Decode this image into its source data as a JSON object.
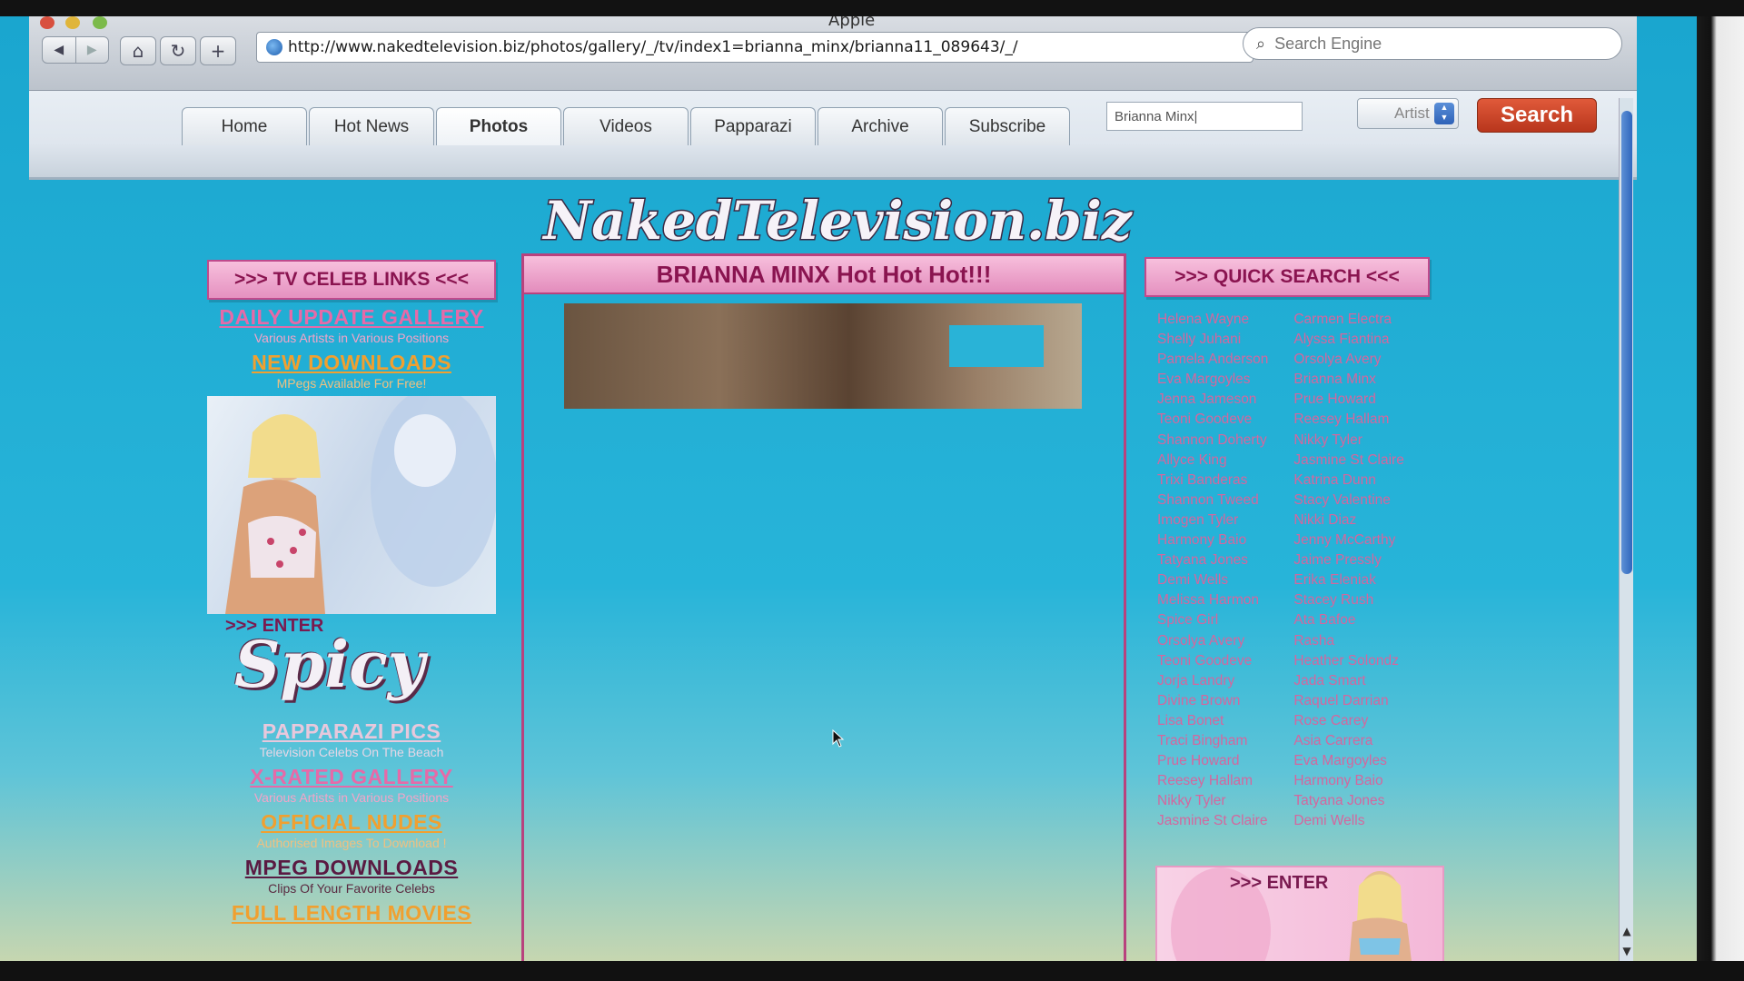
{
  "browser": {
    "title": "Apple",
    "url": "http://www.nakedtelevision.biz/photos/gallery/_/tv/index1=brianna_minx/brianna11_089643/_/",
    "search_placeholder": "Search Engine"
  },
  "site": {
    "logo_text": "NakedTelevision.biz",
    "nav_tabs": [
      {
        "label": "Home"
      },
      {
        "label": "Hot News"
      },
      {
        "label": "Photos"
      },
      {
        "label": "Videos"
      },
      {
        "label": "Papparazi"
      },
      {
        "label": "Archive"
      },
      {
        "label": "Subscribe"
      }
    ],
    "search": {
      "value": "Brianna Minx|",
      "filter": "Artist",
      "button": "Search"
    },
    "left": {
      "header": ">>> TV CELEB LINKS <<<",
      "links": [
        {
          "title": "DAILY UPDATE GALLERY",
          "sub": "Various Artists in Various Positions"
        },
        {
          "title": "NEW DOWNLOADS",
          "sub": "MPegs Available For Free!"
        }
      ],
      "enter_label": ">>> ENTER",
      "spicy": "Spicy",
      "links2": [
        {
          "title": "PAPPARAZI PICS",
          "sub": "Television Celebs On The Beach"
        },
        {
          "title": "X-RATED GALLERY",
          "sub": "Various Artists in Various Positions"
        },
        {
          "title": "OFFICIAL NUDES",
          "sub": "Authorised Images To Download !"
        },
        {
          "title": "MPEG DOWNLOADS",
          "sub": "Clips Of Your Favorite Celebs"
        },
        {
          "title": "FULL LENGTH MOVIES",
          "sub": ""
        }
      ]
    },
    "center": {
      "header": "BRIANNA MINX  Hot Hot Hot!!!"
    },
    "quick_search": {
      "header": ">>> QUICK SEARCH <<<",
      "col1": [
        "Helena Wayne",
        "Shelly Juhani",
        "Pamela Anderson",
        "Eva Margoyles",
        "Jenna Jameson",
        "Teoni Goodeve",
        "Shannon Doherty",
        "Allyce King",
        "Trixi Banderas",
        "Shannon Tweed",
        "Imogen Tyler",
        "Harmony Baio",
        "Tatyana Jones",
        "Demi Wells",
        "Melissa Harmon",
        "Spice Girl",
        "Orsolya Avery",
        "Teoni Goodeve",
        "Jorja Landry",
        "Divine Brown",
        "Lisa Bonet",
        "Traci Bingham",
        "Prue Howard",
        "Reesey Hallam",
        "Nikky Tyler",
        "Jasmine St Claire"
      ],
      "col2": [
        "Carmen Electra",
        "Alyssa Fiantina",
        "Orsolya Avery",
        "Brianna Minx",
        "Prue Howard",
        "Reesey Hallam",
        "Nikky Tyler",
        "Jasmine St Claire",
        "Katrina Dunn",
        "Stacy Valentine",
        "Nikki Diaz",
        "Jenny McCarthy",
        "Jaime Pressly",
        "Erika Eleniak",
        "Stacey Rush",
        "Ata Bafoe",
        "Rasha",
        "Heather Solondz",
        "Jada Smart",
        "Raquel Darrian",
        "Rose Carey",
        "Asia Carrera",
        "Eva Margoyles",
        "Harmony Baio",
        "Tatyana Jones",
        "Demi Wells"
      ],
      "enter_label": ">>> ENTER"
    }
  },
  "colors": {
    "accent_pink": "#e591c0",
    "site_bg": "#27b4d9",
    "search_red": "#c8432a"
  }
}
